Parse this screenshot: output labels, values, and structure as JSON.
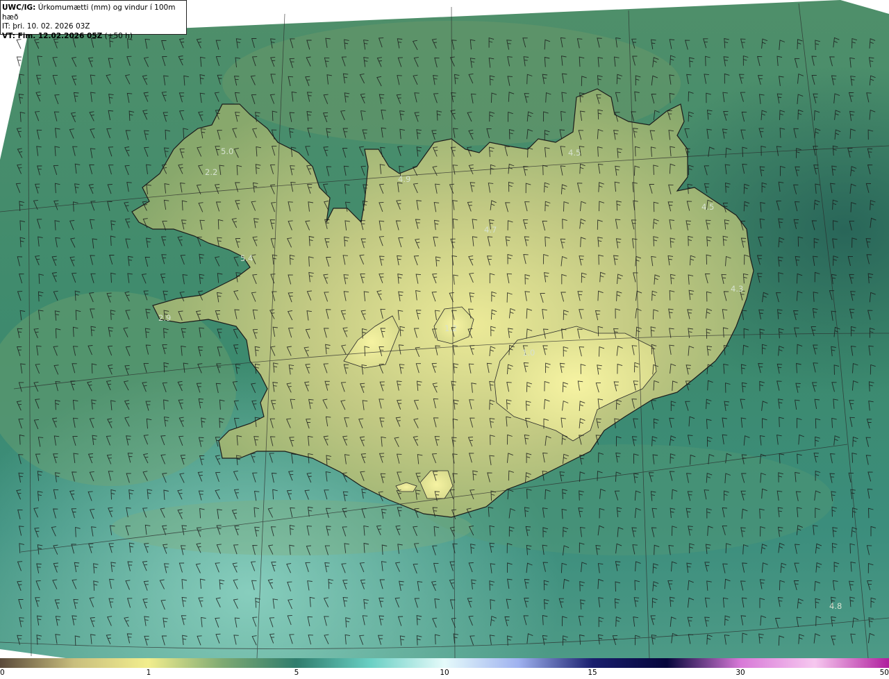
{
  "header": {
    "line1_prefix": "UWC/IG:",
    "line1_text": " Úrkomumætti (mm) og vindur í 100m hæð",
    "line2_text": "IT: þri. 10. 02. 2026 03Z",
    "line3_prefix": "VT:",
    "line3_text": " Fim. 12.02.2026 05Z",
    "line3_suffix": " (+50 h)"
  },
  "station_values": [
    "5.0",
    "2.2",
    "4.9",
    "4.5",
    "4.5",
    "4.7",
    "5.4",
    "2.9",
    "4.3",
    "1.2",
    "1.0",
    "4.8"
  ],
  "colorbar": {
    "ticks": [
      "0",
      "1",
      "5",
      "10",
      "15",
      "30",
      "50"
    ],
    "colors": [
      "#5a4a3a",
      "#c9bf7e",
      "#f2ee8e",
      "#7faa73",
      "#2f7d6d",
      "#6ad0c4",
      "#e6fbfb",
      "#9fb2f0",
      "#1a1f6e",
      "#06063c",
      "#d87ad8",
      "#f7c8f0",
      "#b01e9e"
    ]
  },
  "map_colors": {
    "ocean": "#3f8a6c",
    "ocean_deep": "#2f7465",
    "ocean_light": "#6cb3a0",
    "land_low": "#8fae6f",
    "land_mid": "#b6c47f",
    "land_high": "#e6e394",
    "coast": "#1b1b1b"
  }
}
